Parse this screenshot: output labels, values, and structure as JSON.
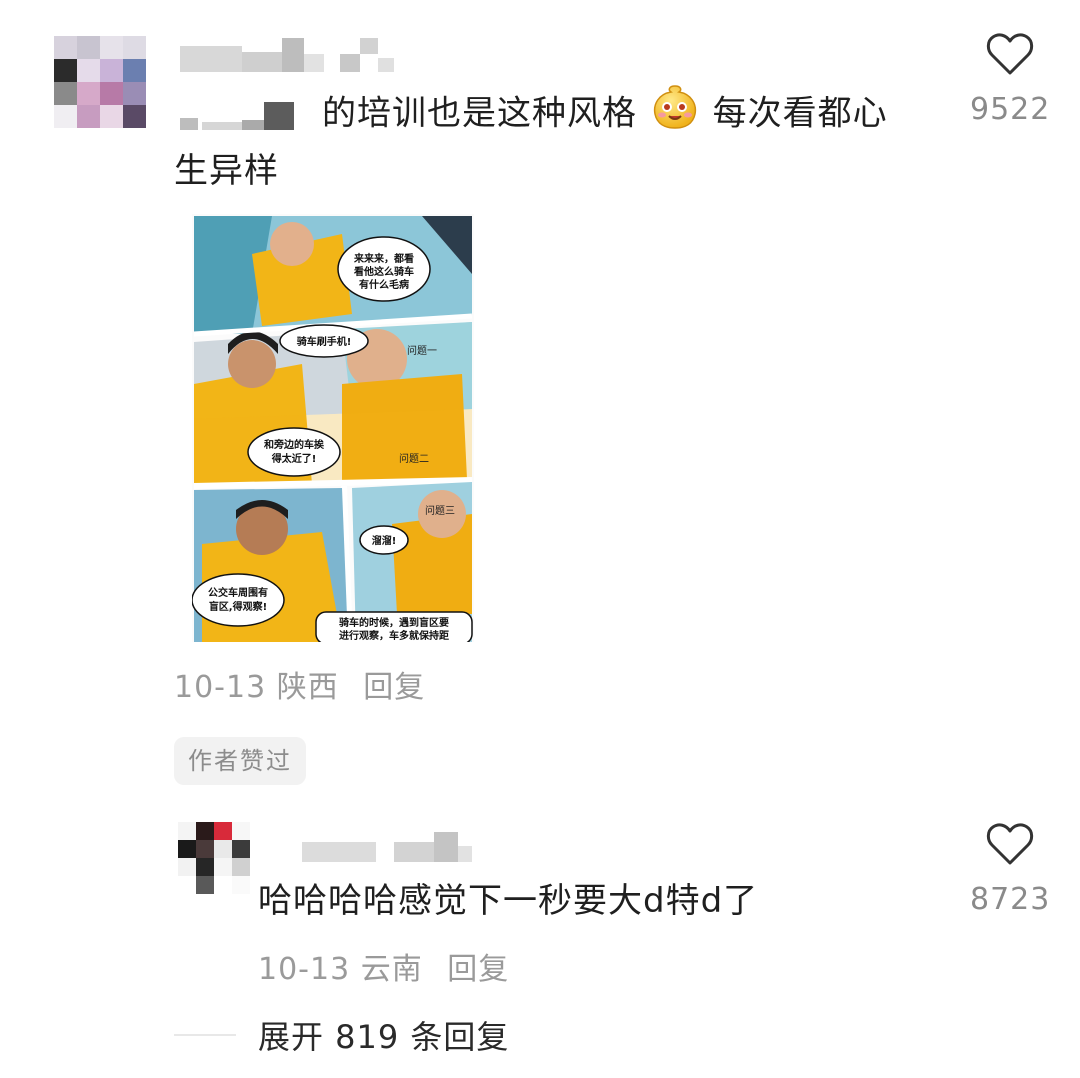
{
  "comments": [
    {
      "text_line1": "的培训也是这种风格",
      "text_line1_after_emoji": "每次看都心",
      "text_line2": "生异样",
      "emoji": "smiling-face-emoji",
      "meta_date": "10-13",
      "meta_location": "陕西",
      "meta_reply": "回复",
      "likes": "9522",
      "author_liked_badge": "作者赞过",
      "comic": {
        "panel1_bubble": [
          "来来来，都看",
          "看他这么骑车",
          "有什么毛病"
        ],
        "panel2_bubble": "骑车刷手机!",
        "panel2_caption": "问题一",
        "panel3_bubble": [
          "和旁边的车挨",
          "得太近了!"
        ],
        "panel3_caption": "问题二",
        "panel4_bubble": [
          "公交车周围有",
          "盲区,得观察!"
        ],
        "panel5_caption": "问题三",
        "panel5_bubble": "溜溜!",
        "panel6_bubble": [
          "骑车的时候，遇到盲区要",
          "进行观察，车多就保持距"
        ]
      }
    },
    {
      "text": "哈哈哈哈感觉下一秒要大d特d了",
      "meta_date": "10-13",
      "meta_location": "云南",
      "meta_reply": "回复",
      "likes": "8723"
    }
  ],
  "expand_replies": "展开 819 条回复",
  "colors": {
    "accent_yellow": "#f2b517",
    "meta_gray": "#9a9a9a"
  },
  "icons": [
    "heart-icon",
    "smiling-face-emoji"
  ]
}
